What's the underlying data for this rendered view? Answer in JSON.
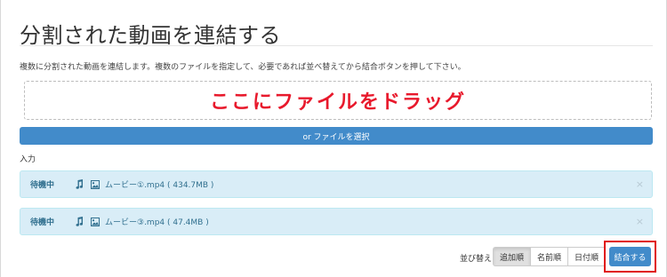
{
  "header": {
    "title": "分割された動画を連結する",
    "description": "複数に分割された動画を連結します。複数のファイルを指定して、必要であれば並べ替えてから結合ボタンを押して下さい。"
  },
  "dropzone": {
    "text": "ここにファイルをドラッグ"
  },
  "select_button": {
    "label": "or ファイルを選択"
  },
  "input_section": {
    "label": "入力"
  },
  "files": [
    {
      "status": "待機中",
      "name": "ムービー①.mp4 ( 434.7MB )",
      "close": "×"
    },
    {
      "status": "待機中",
      "name": "ムービー③.mp4 ( 47.4MB )",
      "close": "×"
    }
  ],
  "sort": {
    "label": "並び替え",
    "options": [
      "追加順",
      "名前順",
      "日付順"
    ],
    "selected": "追加順"
  },
  "merge_button": {
    "label": "結合する"
  },
  "icons": {
    "music": "music-note-icon",
    "image": "image-icon"
  },
  "colors": {
    "primary": "#428bca",
    "dropzone_text": "#e8192c",
    "highlight": "#e01010",
    "file_row_bg": "#d9edf7"
  }
}
